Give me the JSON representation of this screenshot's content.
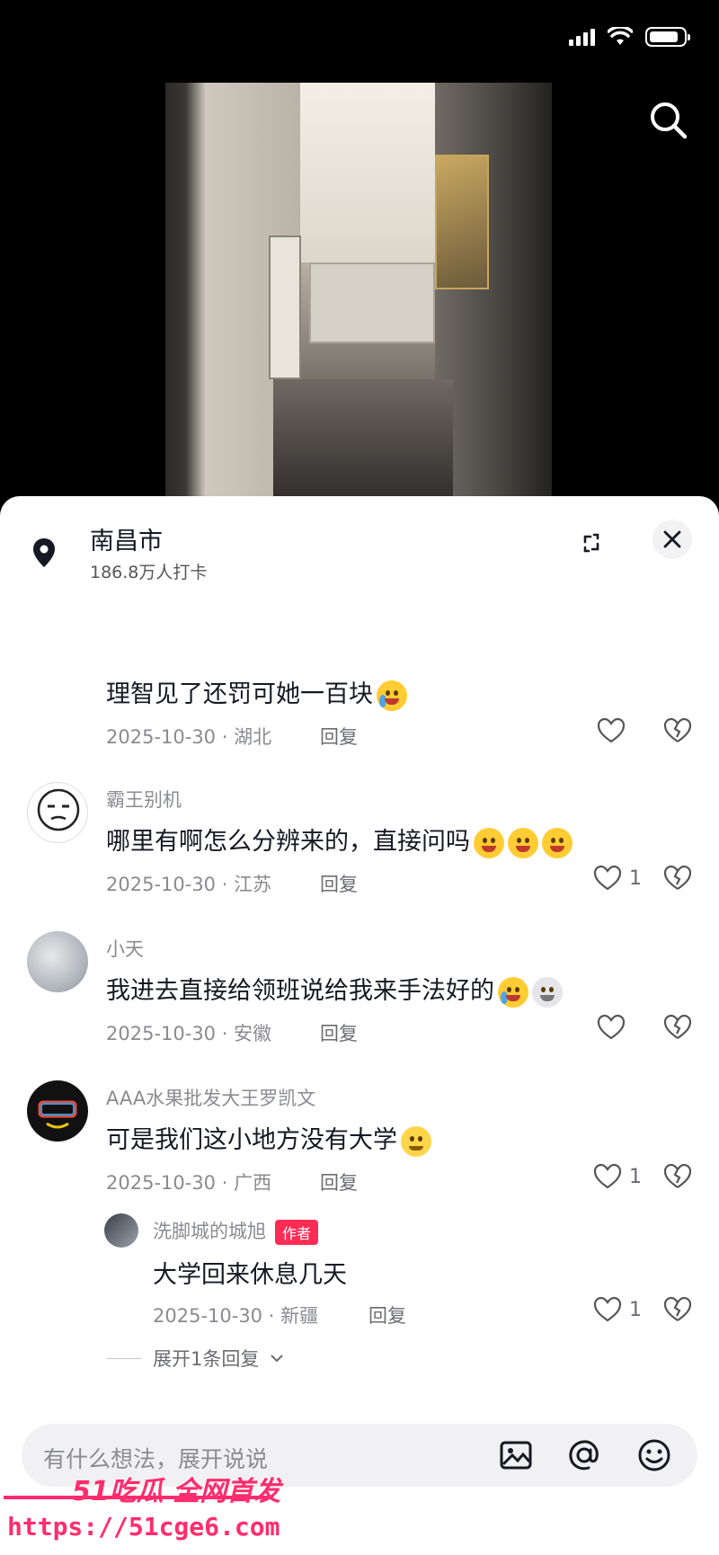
{
  "status_bar": {
    "battery_level": 0.85,
    "signal_bars": 4
  },
  "location": {
    "name": "南昌市",
    "subtitle": "186.8万人打卡"
  },
  "truncated_comment": {
    "partial_line": "理智见了还罚可她一百块",
    "time_place": "2025-10-30 · 湖北",
    "reply_label": "回复"
  },
  "comments": [
    {
      "username": "霸王别机",
      "text": "哪里有啊怎么分辨来的，直接问吗",
      "time_place": "2025-10-30 · 江苏",
      "reply_label": "回复",
      "likes": "1"
    },
    {
      "username": "小天",
      "text": "我进去直接给领班说给我来手法好的",
      "time_place": "2025-10-30 · 安徽",
      "reply_label": "回复",
      "likes": ""
    },
    {
      "username": "AAA水果批发大王罗凯文",
      "text": "可是我们这小地方没有大学",
      "time_place": "2025-10-30 · 广西",
      "reply_label": "回复",
      "likes": "1"
    }
  ],
  "reply": {
    "username": "洗脚城的城旭",
    "badge": "作者",
    "text": "大学回来休息几天",
    "time_place": "2025-10-30 · 新疆",
    "reply_label": "回复",
    "likes": "1"
  },
  "expand_replies_label": "展开1条回复",
  "input": {
    "placeholder": "有什么想法，展开说说"
  },
  "watermark": {
    "logo": "51吃瓜 全网首发",
    "url": "https://51cge6.com"
  }
}
